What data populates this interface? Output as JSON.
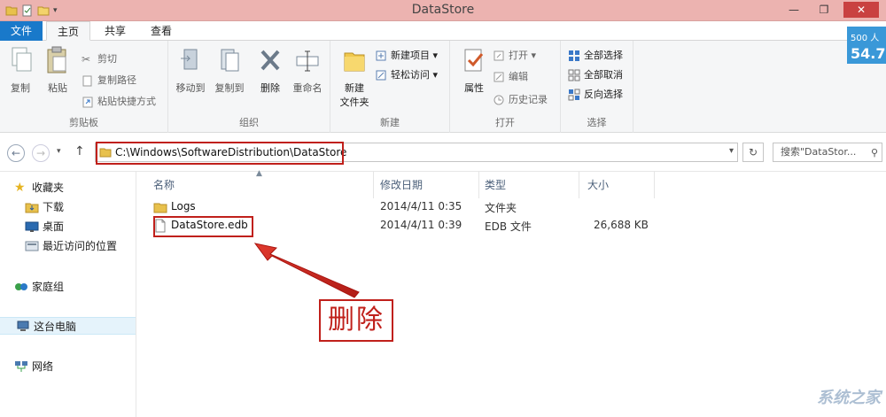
{
  "window": {
    "title": "DataStore"
  },
  "tabs": {
    "file": "文件",
    "home": "主页",
    "share": "共享",
    "view": "查看"
  },
  "ribbon": {
    "clipboard": {
      "label": "剪贴板",
      "copy": "复制",
      "paste": "粘贴",
      "cut": "剪切",
      "copy_path": "复制路径",
      "paste_shortcut": "粘贴快捷方式"
    },
    "organize": {
      "label": "组织",
      "move_to": "移动到",
      "copy_to": "复制到",
      "delete": "删除",
      "rename": "重命名"
    },
    "new": {
      "label": "新建",
      "new_folder_line1": "新建",
      "new_folder_line2": "文件夹",
      "new_item": "新建项目",
      "easy_access": "轻松访问"
    },
    "open": {
      "label": "打开",
      "properties": "属性",
      "open": "打开",
      "edit": "编辑",
      "history": "历史记录"
    },
    "select": {
      "label": "选择",
      "select_all": "全部选择",
      "select_none": "全部取消",
      "invert": "反向选择"
    }
  },
  "address": {
    "path": "C:\\Windows\\SoftwareDistribution\\DataStore",
    "search_placeholder": "搜索\"DataStor..."
  },
  "tray": {
    "line1": "500 人",
    "line2": "54.7"
  },
  "navpane": {
    "favorites": "收藏夹",
    "downloads": "下载",
    "desktop": "桌面",
    "recent": "最近访问的位置",
    "homegroup": "家庭组",
    "this_pc": "这台电脑",
    "network": "网络"
  },
  "columns": {
    "name": "名称",
    "modified": "修改日期",
    "type": "类型",
    "size": "大小"
  },
  "files": [
    {
      "name": "Logs",
      "modified": "2014/4/11 0:35",
      "type": "文件夹",
      "size": "",
      "kind": "folder-icon"
    },
    {
      "name": "DataStore.edb",
      "modified": "2014/4/11 0:39",
      "type": "EDB 文件",
      "size": "26,688 KB",
      "kind": "file-icon"
    }
  ],
  "annotation": {
    "delete_label": "删除"
  },
  "watermark": "系统之家",
  "colors": {
    "accent": "#1979ca",
    "annotation_red": "#c0201b",
    "titlebar": "#ecb3b0"
  }
}
